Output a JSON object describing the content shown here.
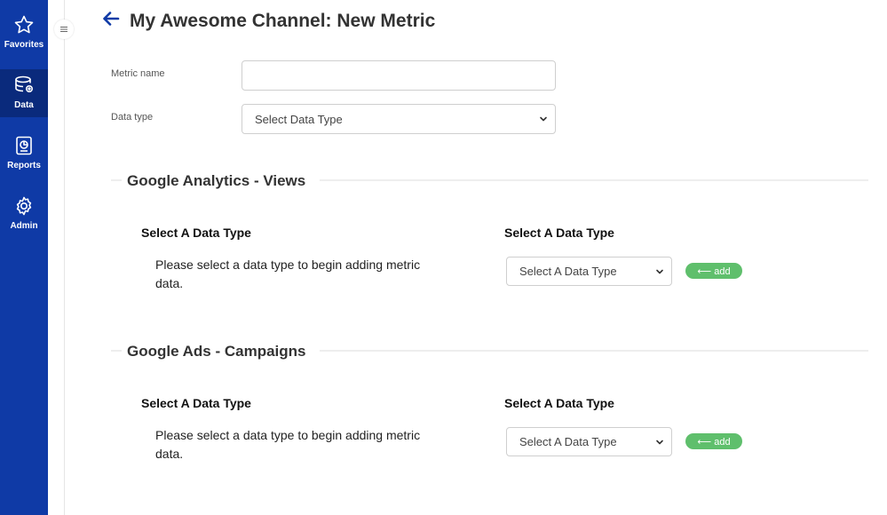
{
  "sidebar": {
    "items": [
      {
        "label": "Favorites",
        "icon": "star-icon"
      },
      {
        "label": "Data",
        "icon": "database-icon"
      },
      {
        "label": "Reports",
        "icon": "report-icon"
      },
      {
        "label": "Admin",
        "icon": "gear-icon"
      }
    ],
    "active": "Data",
    "background": "#0f3aa6"
  },
  "header": {
    "title": "My Awesome Channel: New Metric"
  },
  "form": {
    "metric_name_label": "Metric name",
    "metric_name_value": "",
    "data_type_label": "Data type",
    "data_type_selected": "Select Data Type"
  },
  "sections": [
    {
      "title": "Google Analytics - Views",
      "left_heading": "Select A Data Type",
      "right_heading": "Select A Data Type",
      "help_text": "Please select a data type to begin adding metric data.",
      "select_value": "Select A Data Type",
      "add_label": "⟵ add"
    },
    {
      "title": "Google Ads - Campaigns",
      "left_heading": "Select A Data Type",
      "right_heading": "Select A Data Type",
      "help_text": "Please select a data type to begin adding metric data.",
      "select_value": "Select A Data Type",
      "add_label": "⟵ add"
    }
  ],
  "colors": {
    "accent": "#0f3aa6",
    "add_button": "#5fbf6c"
  }
}
